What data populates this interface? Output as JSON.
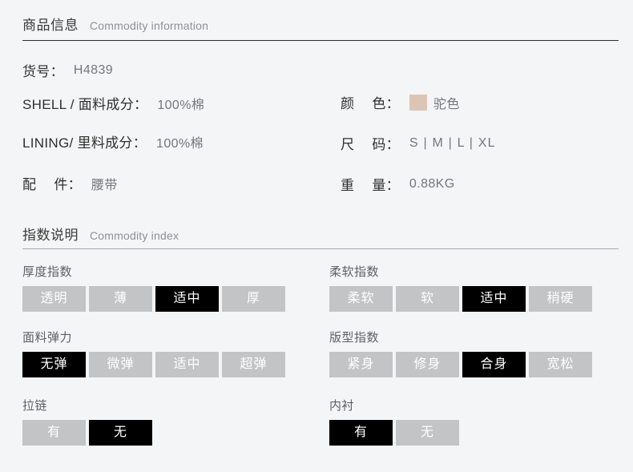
{
  "theme": {
    "background": "#f4f5f6",
    "option_inactive_bg": "#c3c4c6",
    "option_active_bg": "#000000",
    "option_text": "#ffffff",
    "swatch_color": "#ddc5b6"
  },
  "sections": {
    "commodity_information": {
      "title_cn": "商品信息",
      "title_en": "Commodity information"
    },
    "commodity_index": {
      "title_cn": "指数说明",
      "title_en": "Commodity index"
    }
  },
  "info": {
    "article_no": {
      "label": "货号：",
      "value": "H4839"
    },
    "shell": {
      "label": "SHELL / 面料成分：",
      "value": "100%棉"
    },
    "lining": {
      "label": "LINING/ 里料成分：",
      "value": "100%棉"
    },
    "accessory": {
      "label_a": "配",
      "label_b": "件：",
      "value": "腰带"
    },
    "color": {
      "label_a": "颜",
      "label_b": "色：",
      "value": "驼色",
      "swatch": "#ddc5b6"
    },
    "size": {
      "label_a": "尺",
      "label_b": "码：",
      "value": "S | M | L | XL"
    },
    "weight": {
      "label_a": "重",
      "label_b": "量：",
      "value": "0.88KG"
    }
  },
  "index_groups": {
    "thickness": {
      "title": "厚度指数",
      "options": [
        "透明",
        "薄",
        "适中",
        "厚"
      ],
      "selected": "适中"
    },
    "softness": {
      "title": "柔软指数",
      "options": [
        "柔软",
        "软",
        "适中",
        "稍硬"
      ],
      "selected": "适中"
    },
    "elasticity": {
      "title": "面料弹力",
      "options": [
        "无弹",
        "微弹",
        "适中",
        "超弹"
      ],
      "selected": "无弹"
    },
    "fit": {
      "title": "版型指数",
      "options": [
        "紧身",
        "修身",
        "合身",
        "宽松"
      ],
      "selected": "合身"
    },
    "zipper": {
      "title": "拉链",
      "options": [
        "有",
        "无"
      ],
      "selected": "无"
    },
    "inner_lining": {
      "title": "内衬",
      "options": [
        "有",
        "无"
      ],
      "selected": "有"
    }
  }
}
